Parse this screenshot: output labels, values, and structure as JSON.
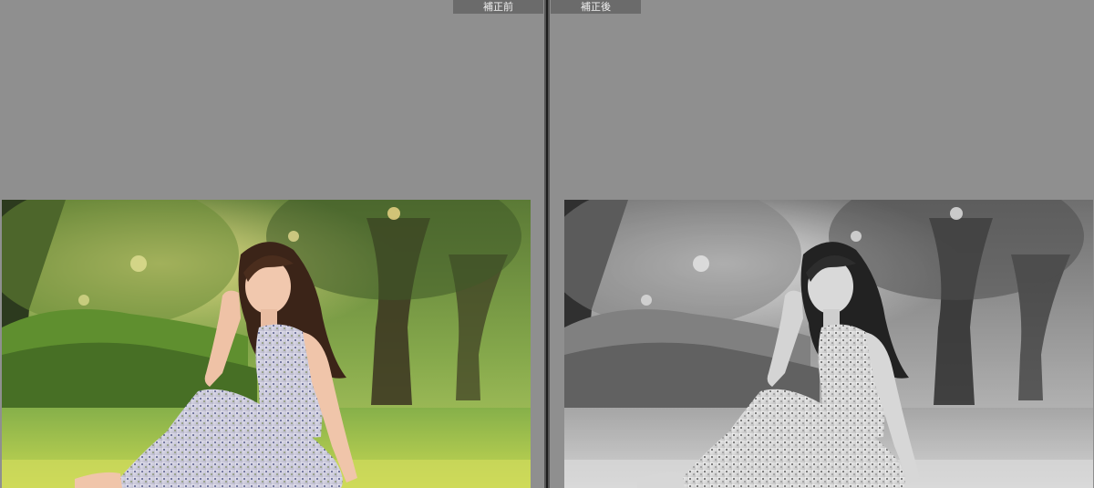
{
  "compare_view": {
    "before_label": "補正前",
    "after_label": "補正後"
  },
  "colors": {
    "background": "#8f8f8f",
    "label_background": "#6b6b6b",
    "divider": "#1c1c1c"
  }
}
